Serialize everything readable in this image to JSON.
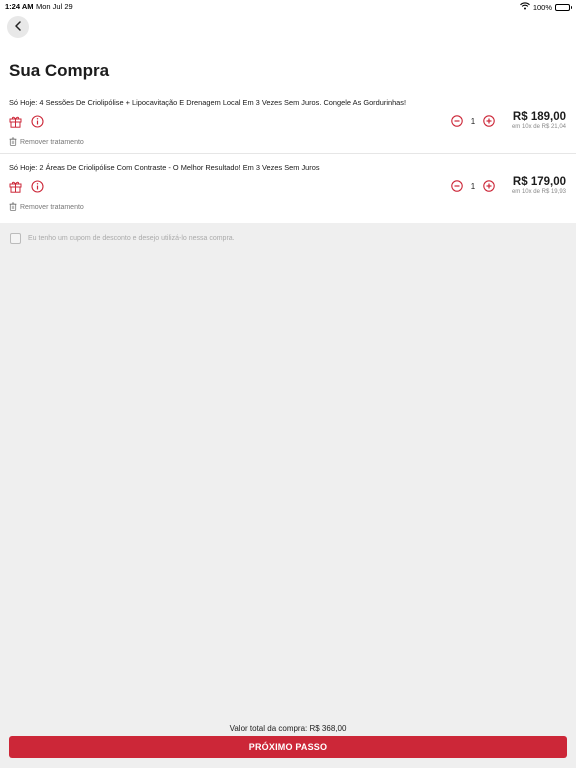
{
  "status": {
    "time": "1:24 AM",
    "date": "Mon Jul 29",
    "battery": "100%"
  },
  "page": {
    "title": "Sua Compra"
  },
  "items": [
    {
      "title": "Só Hoje: 4 Sessões De Criolipólise + Lipocavitação E Drenagem Local Em 3 Vezes Sem Juros. Congele As Gordurinhas!",
      "quantity": "1",
      "price": "R$ 189,00",
      "installments": "em 10x de R$ 21,04",
      "remove_label": "Remover tratamento"
    },
    {
      "title": "Só Hoje: 2 Áreas De Criolipólise Com Contraste - O Melhor Resultado! Em 3 Vezes Sem Juros",
      "quantity": "1",
      "price": "R$ 179,00",
      "installments": "em 10x de R$ 19,93",
      "remove_label": "Remover tratamento"
    }
  ],
  "coupon": {
    "label": "Eu tenho um cupom de desconto e desejo utilizá-lo nessa compra.",
    "checked": false
  },
  "footer": {
    "total_label": "Valor total da compra: R$ 368,00",
    "next_label": "PRÓXIMO PASSO"
  },
  "colors": {
    "accent": "#cc2738",
    "background": "#efefef"
  },
  "icons": [
    "wifi-icon",
    "battery-icon",
    "back-chevron-icon",
    "gift-icon",
    "info-icon",
    "trash-icon",
    "minus-icon",
    "plus-icon",
    "checkbox-icon"
  ]
}
